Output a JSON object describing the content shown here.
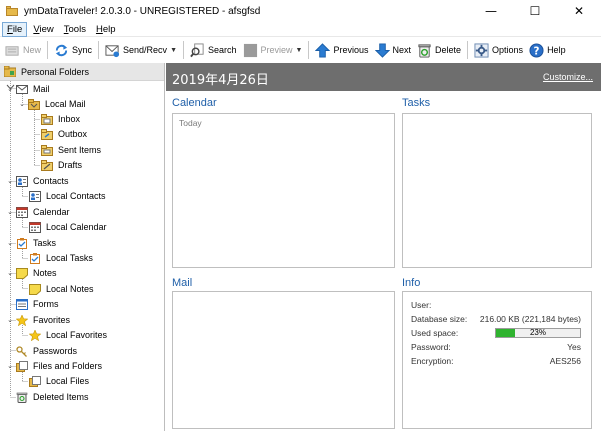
{
  "window": {
    "title": "ymDataTraveler! 2.0.3.0 - UNREGISTERED - afsgfsd",
    "minimize": "—",
    "maximize": "☐",
    "close": "✕"
  },
  "menu": [
    {
      "label": "File",
      "underline": "F",
      "rest": "ile"
    },
    {
      "label": "View",
      "underline": "V",
      "rest": "iew"
    },
    {
      "label": "Tools",
      "underline": "T",
      "rest": "ools"
    },
    {
      "label": "Help",
      "underline": "H",
      "rest": "elp"
    }
  ],
  "toolbar": {
    "new": "New",
    "sync": "Sync",
    "send_recv": "Send/Recv",
    "search": "Search",
    "preview": "Preview",
    "previous": "Previous",
    "next": "Next",
    "delete": "Delete",
    "options": "Options",
    "help": "Help"
  },
  "tree": {
    "root": "Personal Folders",
    "items": [
      {
        "label": "Mail",
        "icon": "mail-icon"
      },
      {
        "label": "Local Mail",
        "icon": "folder-icon"
      },
      {
        "label": "Inbox",
        "icon": "inbox-icon"
      },
      {
        "label": "Outbox",
        "icon": "outbox-icon"
      },
      {
        "label": "Sent Items",
        "icon": "sent-items-icon"
      },
      {
        "label": "Drafts",
        "icon": "drafts-icon"
      },
      {
        "label": "Contacts",
        "icon": "contacts-icon"
      },
      {
        "label": "Local Contacts",
        "icon": "contacts-icon"
      },
      {
        "label": "Calendar",
        "icon": "calendar-icon"
      },
      {
        "label": "Local Calendar",
        "icon": "calendar-icon"
      },
      {
        "label": "Tasks",
        "icon": "tasks-icon"
      },
      {
        "label": "Local Tasks",
        "icon": "tasks-icon"
      },
      {
        "label": "Notes",
        "icon": "notes-icon"
      },
      {
        "label": "Local Notes",
        "icon": "notes-icon"
      },
      {
        "label": "Forms",
        "icon": "forms-icon"
      },
      {
        "label": "Favorites",
        "icon": "star-icon"
      },
      {
        "label": "Local Favorites",
        "icon": "star-icon"
      },
      {
        "label": "Passwords",
        "icon": "key-icon"
      },
      {
        "label": "Files and Folders",
        "icon": "files-icon"
      },
      {
        "label": "Local Files",
        "icon": "files-icon"
      },
      {
        "label": "Deleted Items",
        "icon": "recycle-icon"
      }
    ]
  },
  "main": {
    "date": "2019年4月26日",
    "customize": "Customize...",
    "calendar": {
      "title": "Calendar",
      "today": "Today"
    },
    "tasks": {
      "title": "Tasks"
    },
    "mail": {
      "title": "Mail"
    },
    "info": {
      "title": "Info",
      "user_label": "User:",
      "db_label": "Database size:",
      "db_value": "216.00 KB (221,184 bytes)",
      "used_label": "Used space:",
      "used_value": "23%",
      "used_fraction": 0.23,
      "password_label": "Password:",
      "password_value": "Yes",
      "encryption_label": "Encryption:",
      "encryption_value": "AES256"
    }
  },
  "colors": {
    "accent": "#1f5fa8",
    "date_bar": "#6e6e6e",
    "progress": "#2fb32f"
  }
}
